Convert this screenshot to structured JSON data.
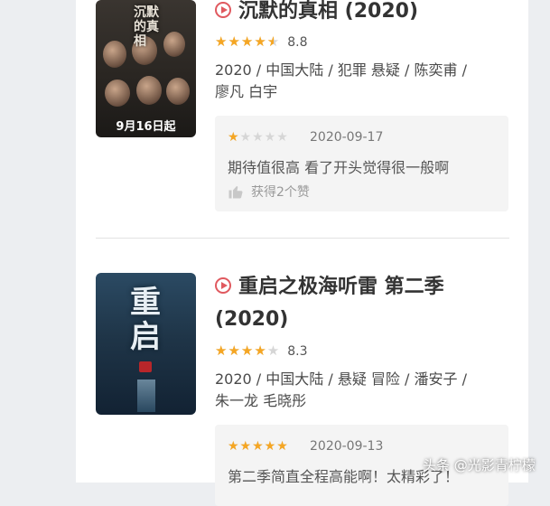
{
  "items": [
    {
      "title": "沉默的真相 (2020)",
      "rating": {
        "stars": 4.5,
        "score": "8.8"
      },
      "meta_line1": "2020 / 中国大陆 / 犯罪 悬疑 / 陈奕甫 /",
      "meta_line2": "廖凡 白宇",
      "poster": {
        "date_text": "9月16日起",
        "title_chars": "沉默的真相"
      },
      "review": {
        "stars": 1,
        "date": "2020-09-17",
        "text": "期待值很高 看了开头觉得很一般啊",
        "likes": "获得2个赞"
      }
    },
    {
      "title_line1": "重启之极海听雷 第二季",
      "title_line2": "(2020)",
      "rating": {
        "stars": 4,
        "score": "8.3"
      },
      "meta_line1": "2020 / 中国大陆 / 悬疑 冒险 / 潘安子 /",
      "meta_line2": "朱一龙 毛晓彤",
      "poster": {
        "title_chars": "重启"
      },
      "review": {
        "stars": 5,
        "date": "2020-09-13",
        "text": "第二季简直全程高能啊！太精彩了！"
      }
    }
  ],
  "watermark": "头条 @光影青柠檬",
  "colors": {
    "accent": "#e0595f",
    "star": "#f5a623"
  }
}
